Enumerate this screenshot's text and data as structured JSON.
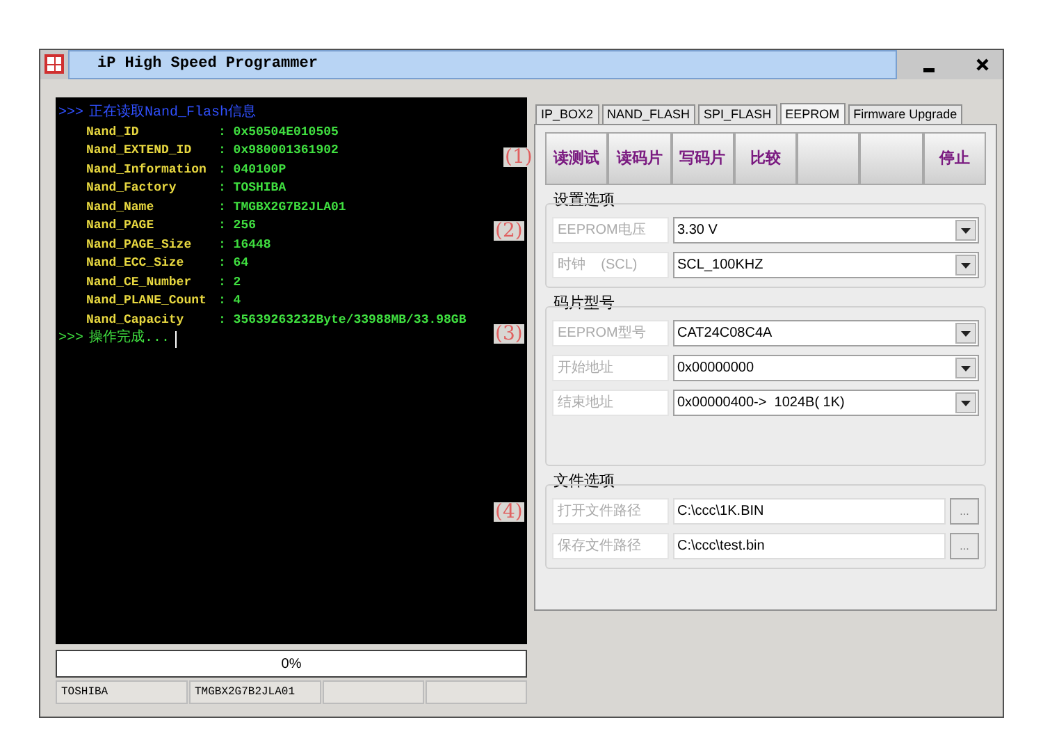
{
  "window": {
    "title": "iP High Speed Programmer"
  },
  "console": [
    {
      "kind": "heading",
      "text": "正在读取Nand_Flash信息"
    },
    {
      "kind": "field",
      "label": "Nand_ID",
      "value": ": 0x50504E010505"
    },
    {
      "kind": "field",
      "label": "Nand_EXTEND_ID",
      "value": ": 0x980001361902"
    },
    {
      "kind": "field",
      "label": "Nand_Information",
      "value": ": 040100P"
    },
    {
      "kind": "field",
      "label": "Nand_Factory",
      "value": ": TOSHIBA"
    },
    {
      "kind": "field",
      "label": "Nand_Name",
      "value": ": TMGBX2G7B2JLA01"
    },
    {
      "kind": "field",
      "label": "Nand_PAGE",
      "value": ": 256"
    },
    {
      "kind": "field",
      "label": "Nand_PAGE_Size",
      "value": ": 16448"
    },
    {
      "kind": "field",
      "label": "Nand_ECC_Size",
      "value": ": 64"
    },
    {
      "kind": "field",
      "label": "Nand_CE_Number",
      "value": ": 2"
    },
    {
      "kind": "field",
      "label": "Nand_PLANE_Count",
      "value": ": 4"
    },
    {
      "kind": "field",
      "label": "Nand_Capacity",
      "value": ": 35639263232Byte/33988MB/33.98GB"
    },
    {
      "kind": "done",
      "text": "操作完成..."
    }
  ],
  "prompt": ">>>",
  "progress": {
    "label": "0%"
  },
  "status_bar": [
    "TOSHIBA",
    "TMGBX2G7B2JLA01"
  ],
  "tabs": [
    {
      "label": "IP_BOX2",
      "selected": false
    },
    {
      "label": "NAND_FLASH",
      "selected": false
    },
    {
      "label": "SPI_FLASH",
      "selected": false
    },
    {
      "label": "EEPROM",
      "selected": true
    },
    {
      "label": "Firmware Upgrade",
      "selected": false
    }
  ],
  "toolbar": {
    "marker": "(1)",
    "buttons": [
      {
        "kind": "text",
        "label": "读测试"
      },
      {
        "kind": "text",
        "label": "读码片"
      },
      {
        "kind": "text",
        "label": "写码片"
      },
      {
        "kind": "text",
        "label": "比较"
      },
      {
        "kind": "blank"
      },
      {
        "kind": "blank"
      },
      {
        "kind": "text",
        "label": "停止"
      }
    ]
  },
  "groups": [
    {
      "title": "设置选项",
      "rows": [
        {
          "kind": "combo",
          "marker": "(2)",
          "label": "EEPROM电压",
          "value": "3.30 V"
        },
        {
          "kind": "combo",
          "label": "时钟    (SCL)",
          "value": "SCL_100KHZ"
        }
      ]
    },
    {
      "title": "码片型号",
      "rows": [
        {
          "kind": "combo",
          "marker": "(3)",
          "label": "EEPROM型号",
          "value": "CAT24C08C4A"
        },
        {
          "kind": "combo",
          "label": "开始地址",
          "value": "0x00000000"
        },
        {
          "kind": "combo",
          "label": "结束地址",
          "value": "0x00000400->  1024B( 1K)"
        }
      ]
    },
    {
      "title": "文件选项",
      "rows": [
        {
          "kind": "path",
          "marker": "(4)",
          "label": "打开文件路径",
          "value": "C:\\ccc\\1K.BIN",
          "button": "..."
        },
        {
          "kind": "path",
          "label": "保存文件路径",
          "value": "C:\\ccc\\test.bin",
          "button": "..."
        }
      ]
    }
  ]
}
